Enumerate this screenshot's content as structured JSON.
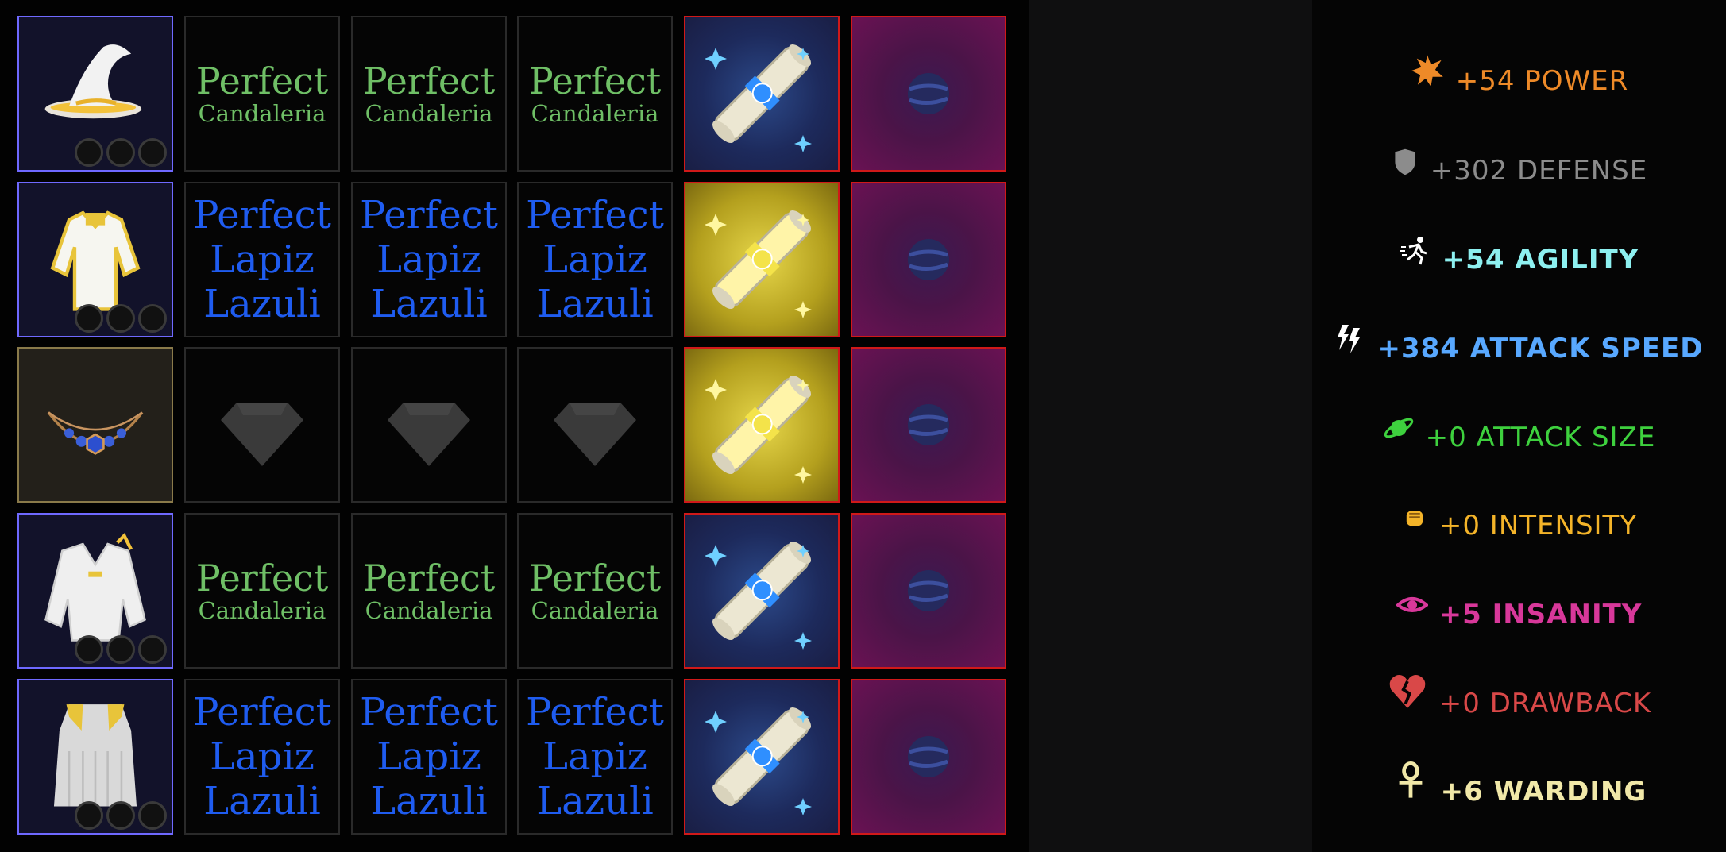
{
  "grid": {
    "rows": [
      {
        "equipment": {
          "name": "wizard-hat",
          "icon": "hat-icon",
          "sockets": 3,
          "border": "#6f69ff"
        },
        "gems": [
          {
            "line1": "Perfect",
            "line2": "Candaleria",
            "color": "green"
          },
          {
            "line1": "Perfect",
            "line2": "Candaleria",
            "color": "green"
          },
          {
            "line1": "Perfect",
            "line2": "Candaleria",
            "color": "green"
          }
        ],
        "scroll": {
          "icon": "blue-scroll-icon",
          "color": "blue"
        },
        "orb": {
          "icon": "orb-icon"
        }
      },
      {
        "equipment": {
          "name": "robe-top",
          "icon": "robe-icon",
          "sockets": 3,
          "border": "#6f69ff"
        },
        "gems": [
          {
            "line1": "Perfect",
            "line2": "Lapiz",
            "line3": "Lazuli",
            "color": "blue"
          },
          {
            "line1": "Perfect",
            "line2": "Lapiz",
            "line3": "Lazuli",
            "color": "blue"
          },
          {
            "line1": "Perfect",
            "line2": "Lapiz",
            "line3": "Lazuli",
            "color": "blue"
          }
        ],
        "scroll": {
          "icon": "gold-scroll-icon",
          "color": "gold"
        },
        "orb": {
          "icon": "orb-icon"
        }
      },
      {
        "equipment": {
          "name": "necklace",
          "icon": "necklace-icon",
          "sockets": 0,
          "border": "#8a7a4a"
        },
        "gems": [
          {
            "icon": "empty-gem-icon"
          },
          {
            "icon": "empty-gem-icon"
          },
          {
            "icon": "empty-gem-icon"
          }
        ],
        "scroll": {
          "icon": "gold-scroll-icon",
          "color": "gold"
        },
        "orb": {
          "icon": "orb-icon"
        }
      },
      {
        "equipment": {
          "name": "fur-coat",
          "icon": "coat-icon",
          "sockets": 3,
          "border": "#6f69ff"
        },
        "gems": [
          {
            "line1": "Perfect",
            "line2": "Candaleria",
            "color": "green"
          },
          {
            "line1": "Perfect",
            "line2": "Candaleria",
            "color": "green"
          },
          {
            "line1": "Perfect",
            "line2": "Candaleria",
            "color": "green"
          }
        ],
        "scroll": {
          "icon": "blue-scroll-icon",
          "color": "blue"
        },
        "orb": {
          "icon": "orb-icon"
        }
      },
      {
        "equipment": {
          "name": "robe-skirt",
          "icon": "skirt-icon",
          "sockets": 3,
          "border": "#6f69ff"
        },
        "gems": [
          {
            "line1": "Perfect",
            "line2": "Lapiz",
            "line3": "Lazuli",
            "color": "blue"
          },
          {
            "line1": "Perfect",
            "line2": "Lapiz",
            "line3": "Lazuli",
            "color": "blue"
          },
          {
            "line1": "Perfect",
            "line2": "Lapiz",
            "line3": "Lazuli",
            "color": "blue"
          }
        ],
        "scroll": {
          "icon": "blue-scroll-icon",
          "color": "blue"
        },
        "orb": {
          "icon": "orb-icon"
        }
      }
    ]
  },
  "stats": [
    {
      "text": "+54 POWER",
      "color": "#ee8a28",
      "icon": "star-burst-icon",
      "bold": false
    },
    {
      "text": "+302 DEFENSE",
      "color": "#8c8c8c",
      "icon": "shield-icon",
      "bold": false
    },
    {
      "text": "+54 AGILITY",
      "color": "#8df0f0",
      "icon": "running-icon",
      "bold": true
    },
    {
      "text": "+384 ATTACK SPEED",
      "color": "#58a8ff",
      "icon": "lightning-icon",
      "bold": true
    },
    {
      "text": "+0 ATTACK SIZE",
      "color": "#3ed13e",
      "icon": "planet-icon",
      "bold": false
    },
    {
      "text": "+0 INTENSITY",
      "color": "#f4b429",
      "icon": "fist-icon",
      "bold": false
    },
    {
      "text": "+5 INSANITY",
      "color": "#d8389a",
      "icon": "eye-icon",
      "bold": true
    },
    {
      "text": "+0 DRAWBACK",
      "color": "#d94848",
      "icon": "broken-heart-icon",
      "bold": false
    },
    {
      "text": "+6 WARDING",
      "color": "#f1e8a8",
      "icon": "ankh-icon",
      "bold": true
    }
  ]
}
